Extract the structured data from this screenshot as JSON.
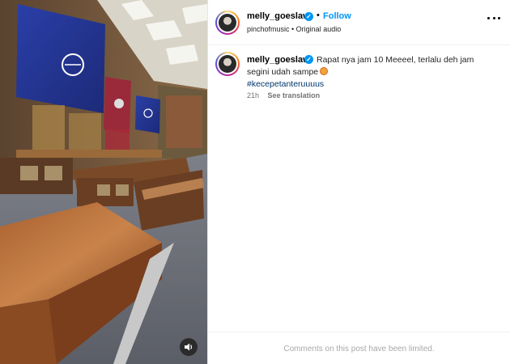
{
  "media": {
    "sound_icon": "speaker-icon"
  },
  "post": {
    "username": "melly_goeslaw",
    "verified": true,
    "separator": "•",
    "follow_label": "Follow",
    "audio": "pinchofmusic • Original audio",
    "more_icon": "more-options-icon"
  },
  "caption": {
    "text": "Rapat nya jam 10 Meeeel, terlalu deh jam segini udah sampe",
    "emoji": "😥",
    "hashtag": "#kecepetanteruuuus",
    "time": "21h",
    "see_translation": "See translation"
  },
  "footer": {
    "comments_limited": "Comments on this post have been limited."
  },
  "colors": {
    "accent": "#0095f6",
    "hashtag": "#00376b",
    "muted": "#737373"
  }
}
